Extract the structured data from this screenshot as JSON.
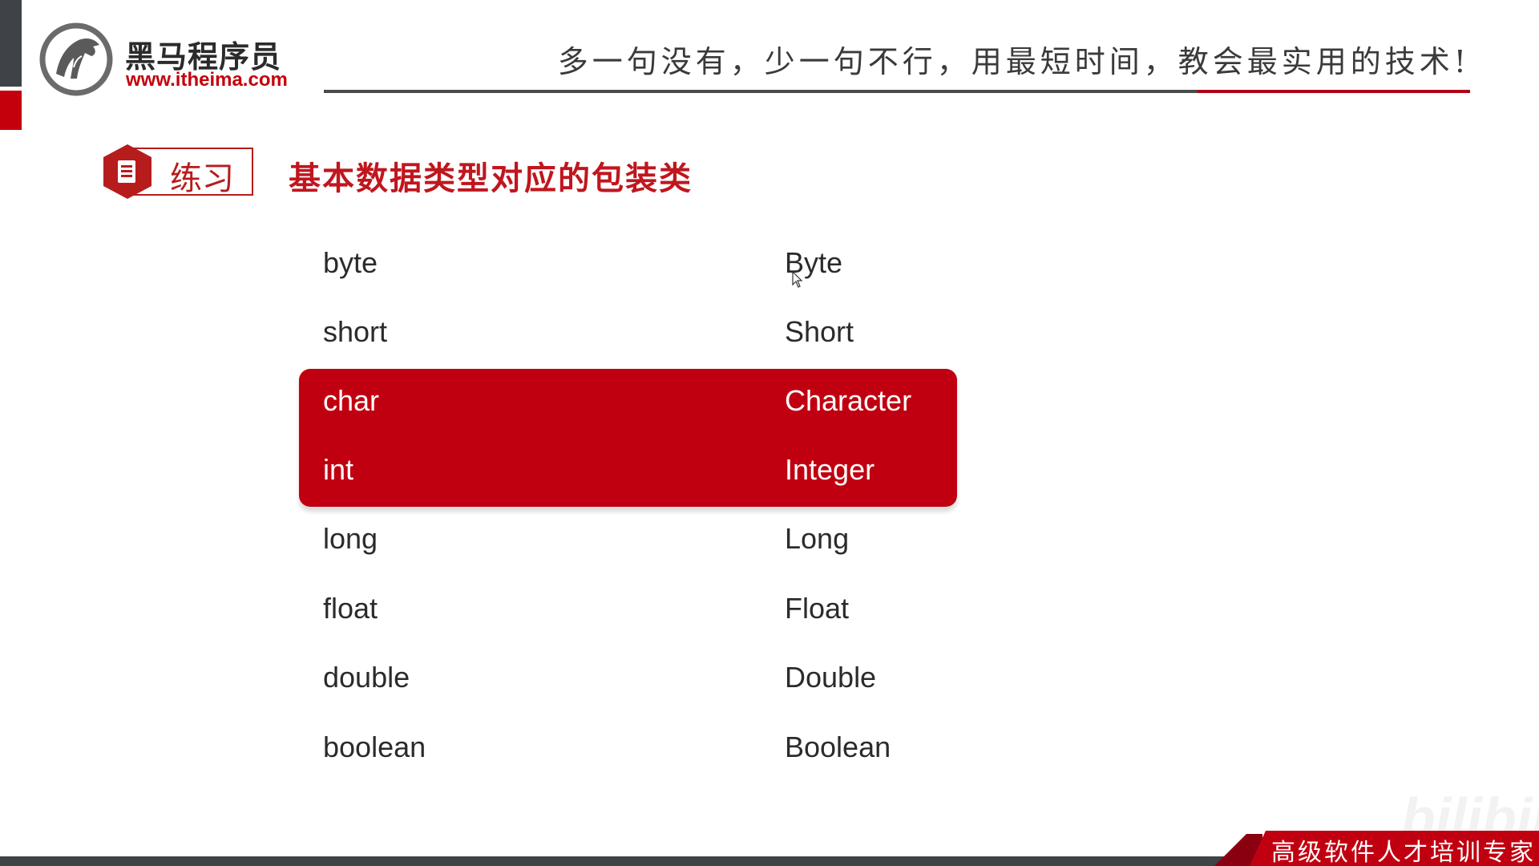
{
  "logo": {
    "name_cn": "黑马程序员",
    "url": "www.itheima.com"
  },
  "header": {
    "slogan": "多一句没有，少一句不行，用最短时间，教会最实用的技术!"
  },
  "section": {
    "badge_label": "练习",
    "title": "基本数据类型对应的包装类",
    "badge_icon": "document-icon"
  },
  "mapping": {
    "rows": [
      {
        "primitive": "byte",
        "wrapper": "Byte",
        "highlighted": false
      },
      {
        "primitive": "short",
        "wrapper": "Short",
        "highlighted": false
      },
      {
        "primitive": "char",
        "wrapper": "Character",
        "highlighted": true
      },
      {
        "primitive": "int",
        "wrapper": "Integer",
        "highlighted": true
      },
      {
        "primitive": "long",
        "wrapper": "Long",
        "highlighted": false
      },
      {
        "primitive": "float",
        "wrapper": "Float",
        "highlighted": false
      },
      {
        "primitive": "double",
        "wrapper": "Double",
        "highlighted": false
      },
      {
        "primitive": "boolean",
        "wrapper": "Boolean",
        "highlighted": false
      }
    ]
  },
  "footer": {
    "tagline": "高级软件人才培训专家",
    "watermark": "bilibili"
  },
  "colors": {
    "brand_red": "#c00010",
    "dark_gray": "#3f4347",
    "text": "#2b2b2b"
  }
}
